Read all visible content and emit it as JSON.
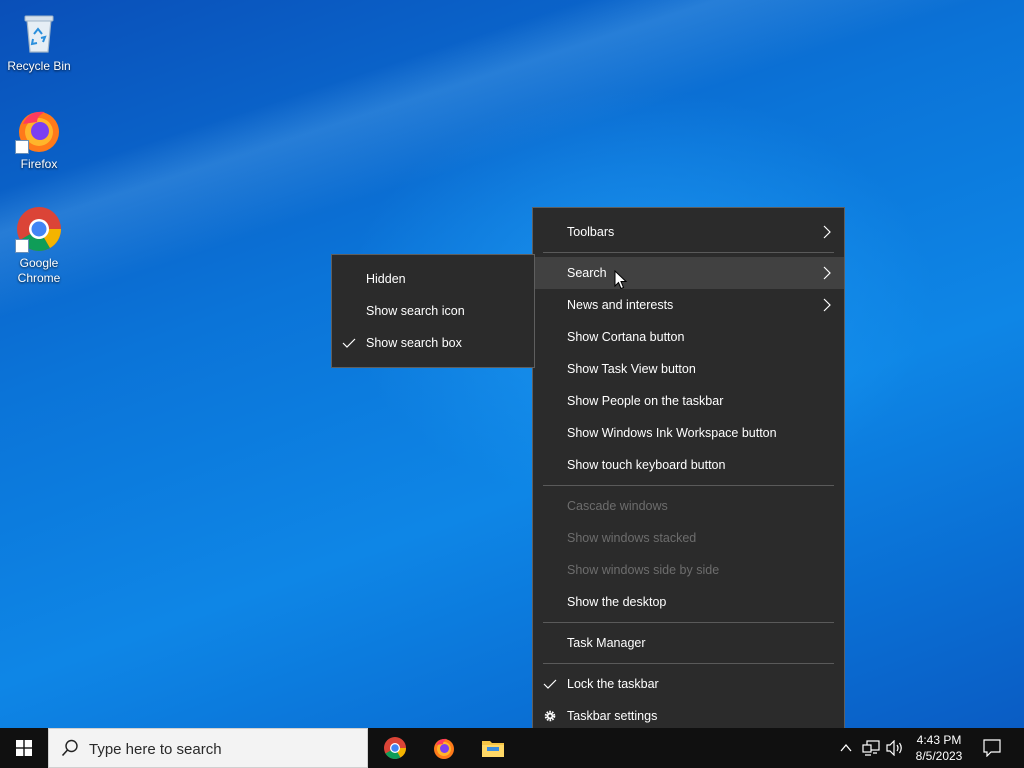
{
  "desktop": {
    "icons": [
      {
        "label": "Recycle Bin"
      },
      {
        "label": "Firefox"
      },
      {
        "label": "Google Chrome"
      }
    ]
  },
  "context_menu": {
    "items": [
      {
        "label": "Toolbars",
        "submenu": true
      },
      {
        "label": "Search",
        "submenu": true,
        "hovered": true
      },
      {
        "label": "News and interests",
        "submenu": true
      },
      {
        "label": "Show Cortana button"
      },
      {
        "label": "Show Task View button"
      },
      {
        "label": "Show People on the taskbar"
      },
      {
        "label": "Show Windows Ink Workspace button"
      },
      {
        "label": "Show touch keyboard button"
      },
      {
        "label": "Cascade windows",
        "disabled": true
      },
      {
        "label": "Show windows stacked",
        "disabled": true
      },
      {
        "label": "Show windows side by side",
        "disabled": true
      },
      {
        "label": "Show the desktop"
      },
      {
        "label": "Task Manager"
      },
      {
        "label": "Lock the taskbar",
        "checked": true
      },
      {
        "label": "Taskbar settings",
        "icon": "gear-icon"
      }
    ]
  },
  "search_submenu": {
    "items": [
      {
        "label": "Hidden"
      },
      {
        "label": "Show search icon"
      },
      {
        "label": "Show search box",
        "checked": true
      }
    ]
  },
  "taskbar": {
    "search_placeholder": "Type here to search",
    "apps": [
      "chrome-icon",
      "firefox-icon",
      "file-explorer-icon"
    ],
    "clock": {
      "time": "4:43 PM",
      "date": "8/5/2023"
    }
  },
  "colors": {
    "menu_bg": "#2b2b2b",
    "menu_hover": "#414141",
    "taskbar_bg": "#101010",
    "desktop_blue": "#0b74d8"
  }
}
